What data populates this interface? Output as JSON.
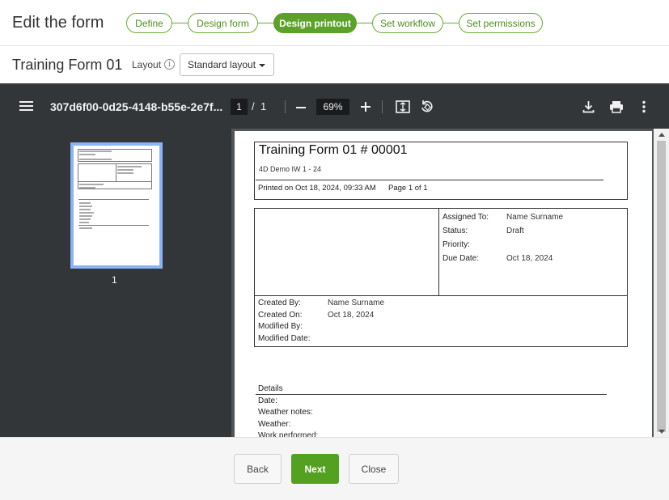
{
  "header": {
    "title": "Edit the form",
    "steps": [
      {
        "label": "Define",
        "active": false
      },
      {
        "label": "Design form",
        "active": false
      },
      {
        "label": "Design printout",
        "active": true
      },
      {
        "label": "Set workflow",
        "active": false
      },
      {
        "label": "Set permissions",
        "active": false
      }
    ]
  },
  "subbar": {
    "form_title": "Training Form 01",
    "layout_label": "Layout",
    "layout_value": "Standard layout"
  },
  "viewer": {
    "doc_name": "307d6f00-0d25-4148-b55e-2e7f...",
    "current_page": "1",
    "page_separator": "/",
    "total_pages": "1",
    "zoom": "69%",
    "thumbnail_label": "1",
    "icons": [
      "menu-icon",
      "zoom-out-icon",
      "zoom-in-icon",
      "fit-page-icon",
      "rotate-icon",
      "download-icon",
      "print-icon",
      "more-icon"
    ]
  },
  "document": {
    "title": "Training Form 01 # 00001",
    "subtitle": "4D Demo IW 1 - 24",
    "printed_on": "Printed on Oct 18, 2024, 09:33 AM",
    "page_info": "Page 1 of 1",
    "assigned_to_label": "Assigned To:",
    "assigned_to_value": "Name Surname",
    "status_label": "Status:",
    "status_value": "Draft",
    "priority_label": "Priority:",
    "due_date_label": "Due Date:",
    "due_date_value": "Oct 18, 2024",
    "created_by_label": "Created By:",
    "created_by_value": "Name Surname",
    "created_on_label": "Created On:",
    "created_on_value": "Oct 18, 2024",
    "modified_by_label": "Modified By:",
    "modified_date_label": "Modified Date:",
    "details_heading": "Details",
    "date_label": "Date:",
    "weather_notes_label": "Weather notes:",
    "weather_label": "Weather:",
    "work_performed_label": "Work performed:"
  },
  "footer": {
    "back_label": "Back",
    "next_label": "Next",
    "close_label": "Close"
  },
  "colors": {
    "accent": "#5ca22a",
    "viewer_toolbar": "#323639",
    "viewer_bg": "#525659"
  }
}
